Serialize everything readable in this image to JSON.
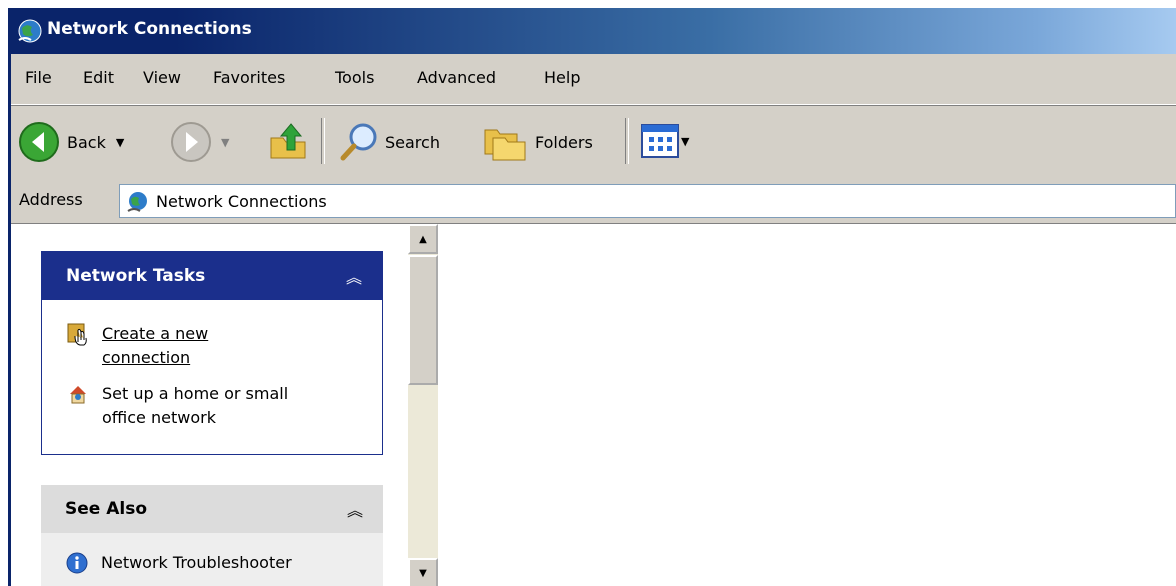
{
  "window": {
    "title": "Network Connections"
  },
  "menu": {
    "items": [
      "File",
      "Edit",
      "View",
      "Favorites",
      "Tools",
      "Advanced",
      "Help"
    ]
  },
  "toolbar": {
    "back_label": "Back",
    "search_label": "Search",
    "folders_label": "Folders"
  },
  "address": {
    "label": "Address",
    "value": "Network Connections"
  },
  "network_tasks": {
    "title": "Network Tasks",
    "items": [
      {
        "line1": "Create a new",
        "line2": "connection"
      },
      {
        "line1": "Set up a home or small",
        "line2": "office network"
      }
    ]
  },
  "see_also": {
    "title": "See Also",
    "items": [
      {
        "label": "Network Troubleshooter"
      }
    ]
  },
  "colors": {
    "title_start": "#0a246a",
    "panel_header_dark": "#1b2f8c",
    "chrome": "#d4d0c8"
  }
}
